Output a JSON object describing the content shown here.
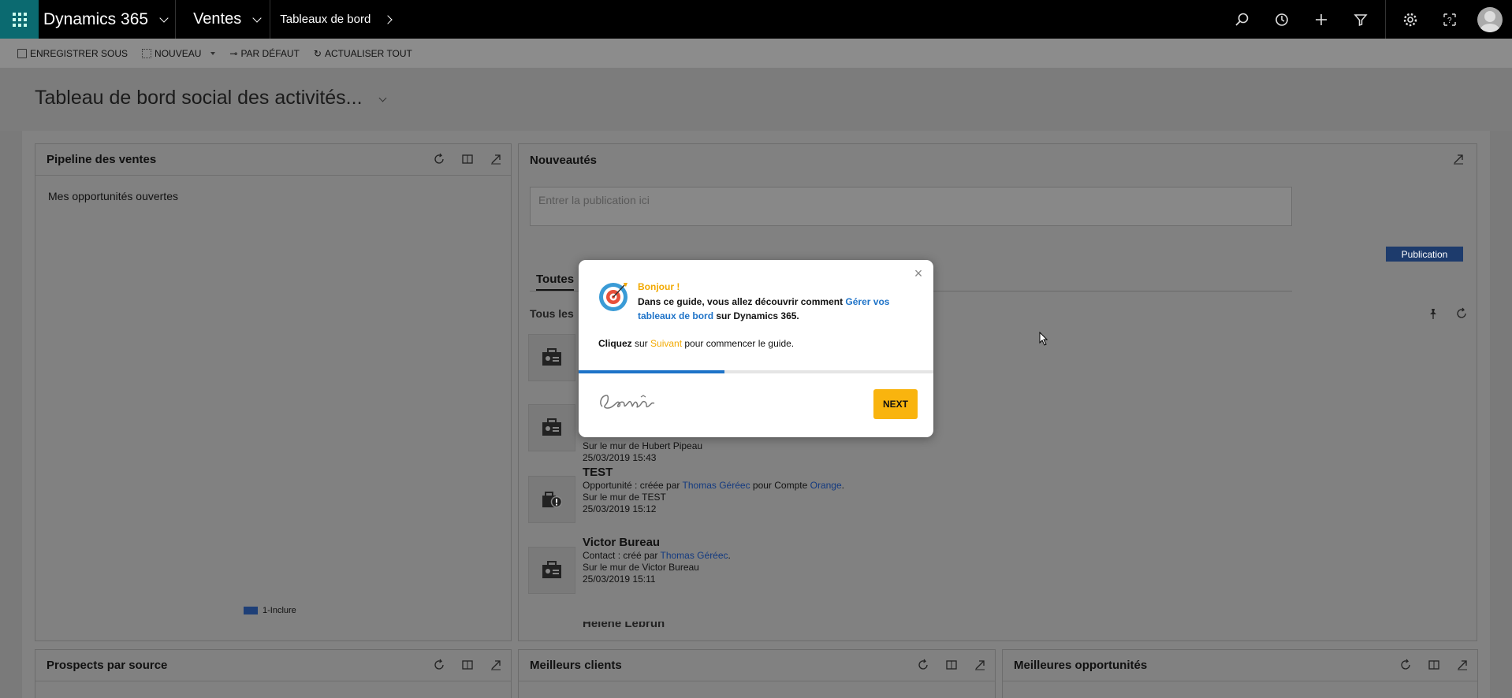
{
  "topbar": {
    "app_name": "Dynamics 365",
    "module": "Ventes",
    "area": "Tableaux de bord"
  },
  "commands": {
    "save_as": "ENREGISTRER SOUS",
    "new": "NOUVEAU",
    "default": "PAR DÉFAUT",
    "refresh_all": "ACTUALISER TOUT"
  },
  "dashboard": {
    "title": "Tableau de bord social des activités..."
  },
  "pipeline": {
    "title": "Pipeline des ventes",
    "subtitle": "Mes opportunités ouvertes",
    "legend": "1-Inclure"
  },
  "news": {
    "title": "Nouveautés",
    "placeholder": "Entrer la publication ici",
    "publish_button": "Publication",
    "tab_all": "Toutes",
    "filter_label": "Tous les",
    "items": [
      {
        "title": "",
        "line1_prefix": "",
        "user": "",
        "line1_mid": "",
        "entity": "",
        "wall": "Sur le mur de Hubert Pipeau",
        "date": "25/03/2019 15:43"
      },
      {
        "title": "TEST",
        "line1_prefix": "Opportunité : créée par ",
        "user": "Thomas Géréec",
        "line1_mid": " pour Compte ",
        "entity": "Orange",
        "wall": "Sur le mur de TEST",
        "date": "25/03/2019 15:12"
      },
      {
        "title": "Victor Bureau",
        "line1_prefix": "Contact : créé par ",
        "user": "Thomas Géréec",
        "line1_mid": "",
        "entity": "",
        "wall": "Sur le mur de Victor Bureau",
        "date": "25/03/2019 15:11"
      },
      {
        "title": "Hélène Lebrun"
      }
    ]
  },
  "bottom_panels": {
    "prospects": "Prospects par source",
    "best_clients": "Meilleurs clients",
    "best_opps": "Meilleures opportunités"
  },
  "guide": {
    "greeting": "Bonjour !",
    "intro_prefix": "Dans ce guide, vous allez découvrir comment ",
    "intro_link": "Gérer vos tableaux de bord",
    "intro_suffix": " sur Dynamics 365.",
    "cta_bold": "Cliquez",
    "cta_mid": " sur ",
    "cta_orange": "Suivant",
    "cta_suffix": " pour commencer le guide.",
    "next_button": "NEXT",
    "progress": 0.41
  },
  "colors": {
    "topbar": "#000000",
    "waffle": "#0b6a70",
    "accent_blue": "#1e73c8",
    "accent_orange": "#f2a900",
    "next_button": "#f9b40e",
    "publish_button": "#1d3b6c"
  }
}
